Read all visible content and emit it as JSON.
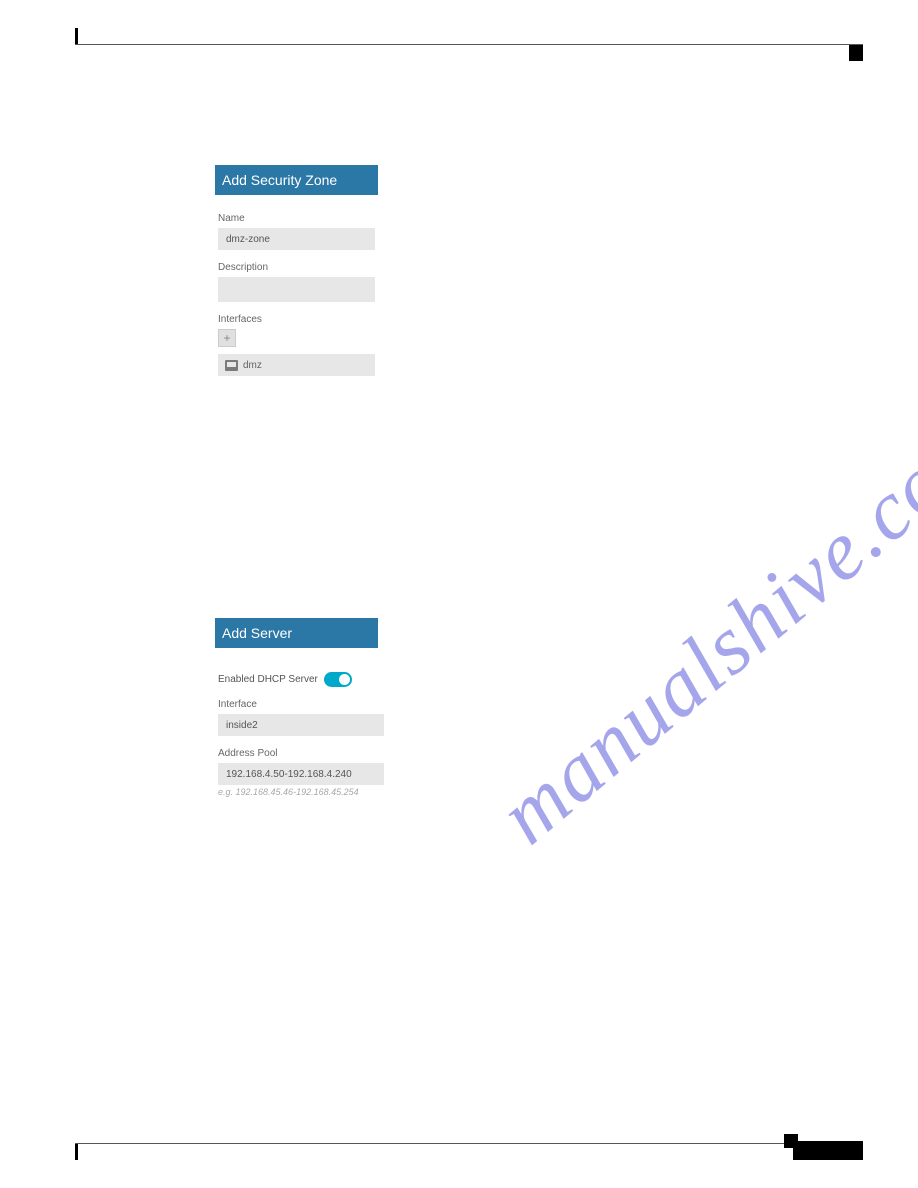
{
  "watermark": "manualshive.com",
  "securityZone": {
    "header": "Add Security Zone",
    "nameLabel": "Name",
    "nameValue": "dmz-zone",
    "descriptionLabel": "Description",
    "descriptionValue": "",
    "interfacesLabel": "Interfaces",
    "addIcon": "+",
    "interfaceItem": "dmz"
  },
  "server": {
    "header": "Add Server",
    "enableLabel": "Enabled DHCP Server",
    "enabled": true,
    "interfaceLabel": "Interface",
    "interfaceValue": "inside2",
    "poolLabel": "Address Pool",
    "poolValue": "192.168.4.50-192.168.4.240",
    "poolHint": "e.g. 192.168.45.46-192.168.45.254"
  }
}
